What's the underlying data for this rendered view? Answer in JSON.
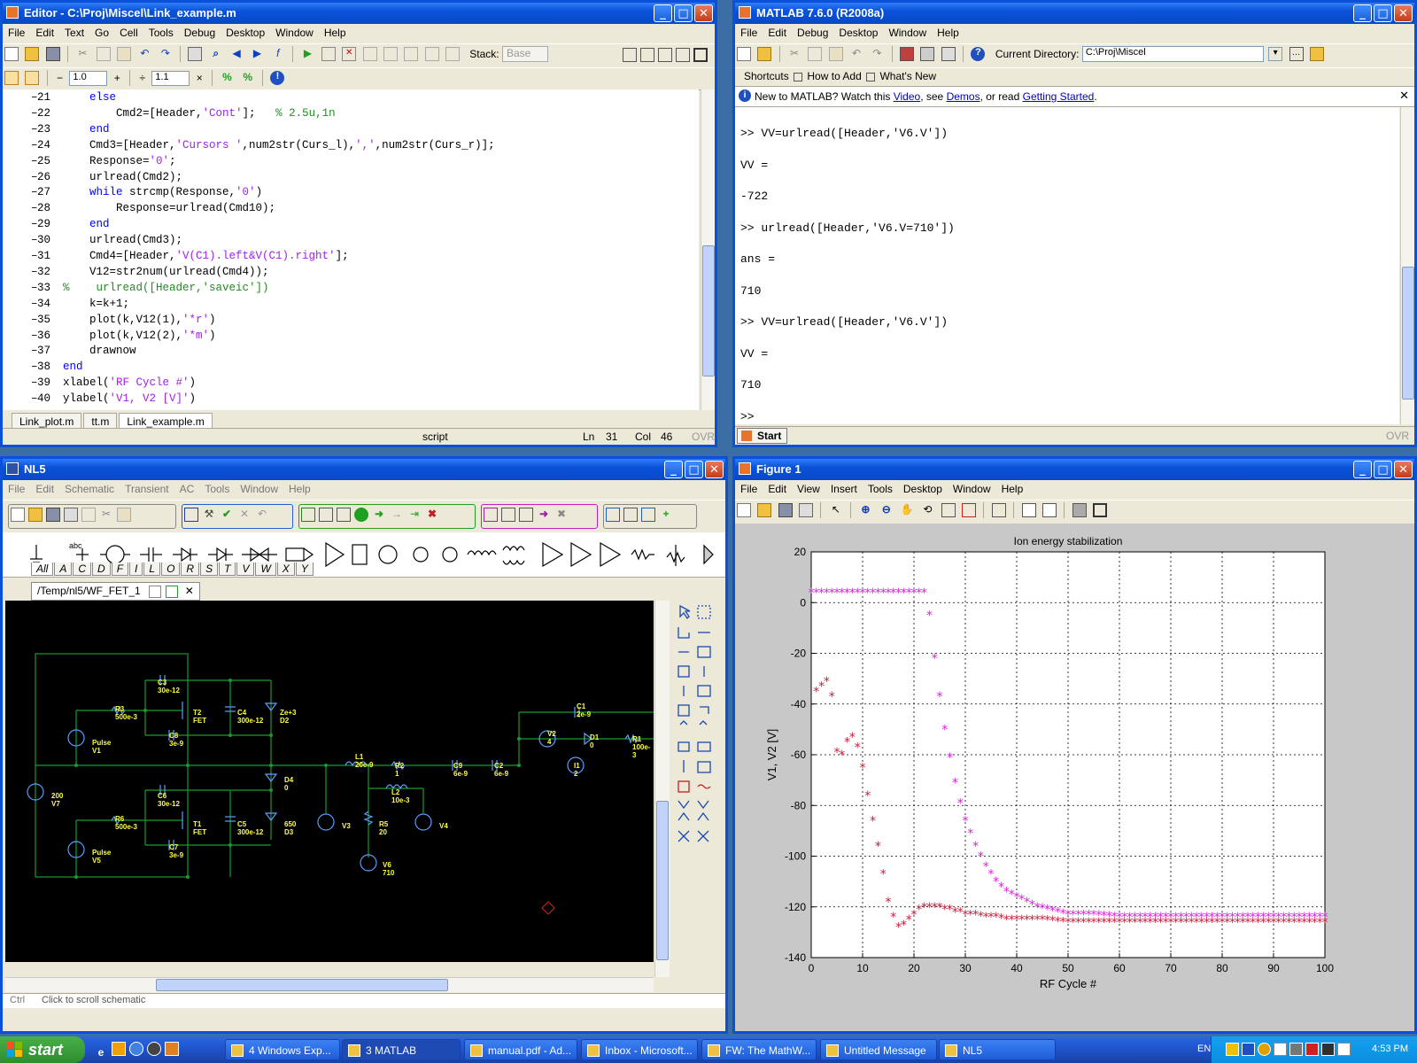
{
  "editor": {
    "title": "Editor - C:\\Proj\\Miscel\\Link_example.m",
    "menu": [
      "File",
      "Edit",
      "Text",
      "Go",
      "Cell",
      "Tools",
      "Debug",
      "Desktop",
      "Window",
      "Help"
    ],
    "stack_label": "Stack:",
    "stack_value": "Base",
    "field1": "1.0",
    "field2": "1.1",
    "lines": [
      {
        "n": "21",
        "t": "else",
        "c": "kw",
        "i": "    "
      },
      {
        "n": "22",
        "t": "Cmd2=[Header,'Cont'];   % 2.5u,1n",
        "c": "",
        "i": "        "
      },
      {
        "n": "23",
        "t": "end",
        "c": "kw",
        "i": "    "
      },
      {
        "n": "24",
        "t": "Cmd3=[Header,'Cursors ',num2str(Curs_l),',',num2str(Curs_r)];",
        "c": "",
        "i": "    "
      },
      {
        "n": "25",
        "t": "Response='0';",
        "c": "",
        "i": "    "
      },
      {
        "n": "26",
        "t": "urlread(Cmd2);",
        "c": "",
        "i": "    "
      },
      {
        "n": "27",
        "t": "while strcmp(Response,'0')",
        "c": "",
        "i": "    "
      },
      {
        "n": "28",
        "t": "Response=urlread(Cmd10);",
        "c": "",
        "i": "        "
      },
      {
        "n": "29",
        "t": "end",
        "c": "kw",
        "i": "    "
      },
      {
        "n": "30",
        "t": "urlread(Cmd3);",
        "c": "",
        "i": "    "
      },
      {
        "n": "31",
        "t": "Cmd4=[Header,'V(C1).left&V(C1).right'];",
        "c": "",
        "i": "    "
      },
      {
        "n": "32",
        "t": "V12=str2num(urlread(Cmd4));",
        "c": "",
        "i": "    "
      },
      {
        "n": "33",
        "t": "%    urlread([Header,'saveic'])",
        "c": "cm",
        "i": ""
      },
      {
        "n": "34",
        "t": "k=k+1;",
        "c": "",
        "i": "    "
      },
      {
        "n": "35",
        "t": "plot(k,V12(1),'*r')",
        "c": "",
        "i": "    "
      },
      {
        "n": "36",
        "t": "plot(k,V12(2),'*m')",
        "c": "",
        "i": "    "
      },
      {
        "n": "37",
        "t": "drawnow",
        "c": "",
        "i": "    "
      },
      {
        "n": "38",
        "t": "end",
        "c": "kw",
        "i": ""
      },
      {
        "n": "39",
        "t": "xlabel('RF Cycle #')",
        "c": "",
        "i": ""
      },
      {
        "n": "40",
        "t": "ylabel('V1, V2 [V]')",
        "c": "",
        "i": ""
      }
    ],
    "tabs": [
      "Link_plot.m",
      "tt.m",
      "Link_example.m"
    ],
    "status_mode": "script",
    "status_ln_label": "Ln",
    "status_ln": "31",
    "status_col_label": "Col",
    "status_col": "46",
    "status_ovr": "OVR"
  },
  "matlab": {
    "title": "MATLAB  7.6.0 (R2008a)",
    "menu": [
      "File",
      "Edit",
      "Debug",
      "Desktop",
      "Window",
      "Help"
    ],
    "current_dir_label": "Current Directory:",
    "current_dir": "C:\\Proj\\Miscel",
    "shortcuts": [
      "Shortcuts",
      "How to Add",
      "What's New"
    ],
    "info_text": "New to MATLAB? Watch this ",
    "info_video": "Video",
    "info_mid": ", see ",
    "info_demos": "Demos",
    "info_or": ", or read ",
    "info_gs": "Getting Started",
    "info_end": ".",
    "cmd_lines": [
      ">> VV=urlread([Header,'V6.V'])",
      "VV =",
      "-722",
      ">> urlread([Header,'V6.V=710'])",
      "ans =",
      "710",
      ">> VV=urlread([Header,'V6.V'])",
      "VV =",
      "710",
      ">>"
    ],
    "start_label": "Start",
    "ovr": "OVR"
  },
  "nl5": {
    "title": "NL5",
    "menu": [
      "File",
      "Edit",
      "Schematic",
      "Transient",
      "AC",
      "Tools",
      "Window",
      "Help"
    ],
    "comp_tabs": [
      "All",
      "A",
      "C",
      "D",
      "F",
      "I",
      "L",
      "O",
      "R",
      "S",
      "T",
      "V",
      "W",
      "X",
      "Y"
    ],
    "doc_tab": "/Temp/nl5/WF_FET_1",
    "status_left": "Ctrl",
    "status_text": "Click to scroll schematic",
    "components": [
      {
        "name": "C3",
        "val": "30e-12",
        "x": 172,
        "y": 88
      },
      {
        "name": "R3",
        "val": "500e-3",
        "x": 124,
        "y": 118
      },
      {
        "name": "T2",
        "val": "FET",
        "x": 212,
        "y": 122
      },
      {
        "name": "C4",
        "val": "300e-12",
        "x": 262,
        "y": 122
      },
      {
        "name": "Ze+3",
        "val": "D2",
        "x": 310,
        "y": 122
      },
      {
        "name": "C8",
        "val": "3e-9",
        "x": 185,
        "y": 148
      },
      {
        "name": "Pulse",
        "val": "V1",
        "x": 98,
        "y": 156
      },
      {
        "name": "L1",
        "val": "20e-9",
        "x": 395,
        "y": 172
      },
      {
        "name": "R2",
        "val": "1",
        "x": 440,
        "y": 182
      },
      {
        "name": "C9",
        "val": "6e-9",
        "x": 506,
        "y": 182
      },
      {
        "name": "C2",
        "val": "6e-9",
        "x": 552,
        "y": 182
      },
      {
        "name": "C1",
        "val": "2e-9",
        "x": 645,
        "y": 115
      },
      {
        "name": "V2",
        "val": "4",
        "x": 612,
        "y": 146
      },
      {
        "name": "D1",
        "val": "0",
        "x": 660,
        "y": 150
      },
      {
        "name": "R1",
        "val": "100e-3",
        "x": 708,
        "y": 152
      },
      {
        "name": "I1",
        "val": "2",
        "x": 642,
        "y": 182
      },
      {
        "name": "D4",
        "val": "0",
        "x": 315,
        "y": 198
      },
      {
        "name": "L2",
        "val": "10e-3",
        "x": 436,
        "y": 212
      },
      {
        "name": "200",
        "val": "V7",
        "x": 52,
        "y": 216
      },
      {
        "name": "C6",
        "val": "30e-12",
        "x": 172,
        "y": 216
      },
      {
        "name": "R6",
        "val": "500e-3",
        "x": 124,
        "y": 242
      },
      {
        "name": "T1",
        "val": "FET",
        "x": 212,
        "y": 248
      },
      {
        "name": "C5",
        "val": "300e-12",
        "x": 262,
        "y": 248
      },
      {
        "name": "650",
        "val": "D3",
        "x": 315,
        "y": 248
      },
      {
        "name": "V3",
        "val": "",
        "x": 380,
        "y": 250
      },
      {
        "name": "R5",
        "val": "20",
        "x": 422,
        "y": 248
      },
      {
        "name": "V4",
        "val": "",
        "x": 490,
        "y": 250
      },
      {
        "name": "C7",
        "val": "3e-9",
        "x": 185,
        "y": 274
      },
      {
        "name": "Pulse",
        "val": "V5",
        "x": 98,
        "y": 280
      },
      {
        "name": "V6",
        "val": "710",
        "x": 426,
        "y": 294
      }
    ]
  },
  "figure": {
    "title": "Figure 1",
    "menu": [
      "File",
      "Edit",
      "View",
      "Insert",
      "Tools",
      "Desktop",
      "Window",
      "Help"
    ]
  },
  "chart_data": {
    "type": "scatter",
    "title": "Ion energy stabilization",
    "xlabel": "RF Cycle #",
    "ylabel": "V1, V2 [V]",
    "xlim": [
      0,
      100
    ],
    "ylim": [
      -140,
      20
    ],
    "xticks": [
      0,
      10,
      20,
      30,
      40,
      50,
      60,
      70,
      80,
      90,
      100
    ],
    "yticks": [
      20,
      0,
      -20,
      -40,
      -60,
      -80,
      -100,
      -120,
      -140
    ],
    "grid": true,
    "series": [
      {
        "color": "#c81e3c",
        "marker": "*",
        "points": [
          [
            1,
            -35
          ],
          [
            2,
            -33
          ],
          [
            3,
            -31
          ],
          [
            4,
            -37
          ],
          [
            5,
            -59
          ],
          [
            6,
            -60
          ],
          [
            7,
            -55
          ],
          [
            8,
            -53
          ],
          [
            9,
            -57
          ],
          [
            10,
            -65
          ],
          [
            11,
            -76
          ],
          [
            12,
            -86
          ],
          [
            13,
            -96
          ],
          [
            14,
            -107
          ],
          [
            15,
            -118
          ],
          [
            16,
            -124
          ],
          [
            17,
            -128
          ],
          [
            18,
            -127
          ],
          [
            19,
            -125
          ],
          [
            20,
            -123
          ],
          [
            21,
            -121
          ],
          [
            22,
            -120
          ],
          [
            23,
            -120
          ],
          [
            24,
            -120
          ],
          [
            25,
            -120
          ],
          [
            26,
            -121
          ],
          [
            27,
            -121
          ],
          [
            28,
            -122
          ],
          [
            29,
            -122
          ],
          [
            30,
            -123
          ],
          [
            32,
            -123
          ],
          [
            34,
            -124
          ],
          [
            36,
            -124
          ],
          [
            38,
            -125
          ],
          [
            40,
            -125
          ],
          [
            45,
            -125
          ],
          [
            50,
            -126
          ],
          [
            55,
            -126
          ],
          [
            60,
            -126
          ],
          [
            65,
            -126
          ],
          [
            70,
            -126
          ],
          [
            75,
            -126
          ],
          [
            80,
            -126
          ],
          [
            85,
            -126
          ],
          [
            90,
            -126
          ],
          [
            95,
            -126
          ],
          [
            100,
            -126
          ]
        ]
      },
      {
        "color": "#e020e0",
        "marker": "*",
        "points": [
          [
            0,
            4
          ],
          [
            2,
            4
          ],
          [
            4,
            4
          ],
          [
            6,
            4
          ],
          [
            8,
            4
          ],
          [
            10,
            4
          ],
          [
            12,
            4
          ],
          [
            14,
            4
          ],
          [
            16,
            4
          ],
          [
            18,
            4
          ],
          [
            20,
            4
          ],
          [
            22,
            4
          ],
          [
            23,
            -5
          ],
          [
            24,
            -22
          ],
          [
            25,
            -37
          ],
          [
            26,
            -50
          ],
          [
            27,
            -61
          ],
          [
            28,
            -71
          ],
          [
            29,
            -79
          ],
          [
            30,
            -86
          ],
          [
            31,
            -91
          ],
          [
            32,
            -96
          ],
          [
            33,
            -100
          ],
          [
            34,
            -104
          ],
          [
            35,
            -107
          ],
          [
            36,
            -110
          ],
          [
            37,
            -112
          ],
          [
            38,
            -114
          ],
          [
            39,
            -115
          ],
          [
            40,
            -116
          ],
          [
            42,
            -118
          ],
          [
            44,
            -120
          ],
          [
            46,
            -121
          ],
          [
            48,
            -122
          ],
          [
            50,
            -123
          ],
          [
            55,
            -123
          ],
          [
            60,
            -124
          ],
          [
            65,
            -124
          ],
          [
            70,
            -124
          ],
          [
            75,
            -124
          ],
          [
            80,
            -124
          ],
          [
            85,
            -124
          ],
          [
            90,
            -124
          ],
          [
            95,
            -124
          ],
          [
            100,
            -124
          ]
        ]
      }
    ]
  },
  "taskbar": {
    "start": "start",
    "items": [
      "4 Windows Exp...",
      "3 MATLAB",
      "manual.pdf - Ad...",
      "Inbox - Microsoft...",
      "FW: The MathW...",
      "Untitled Message",
      "NL5"
    ],
    "lang": "EN",
    "time": "4:53 PM"
  }
}
